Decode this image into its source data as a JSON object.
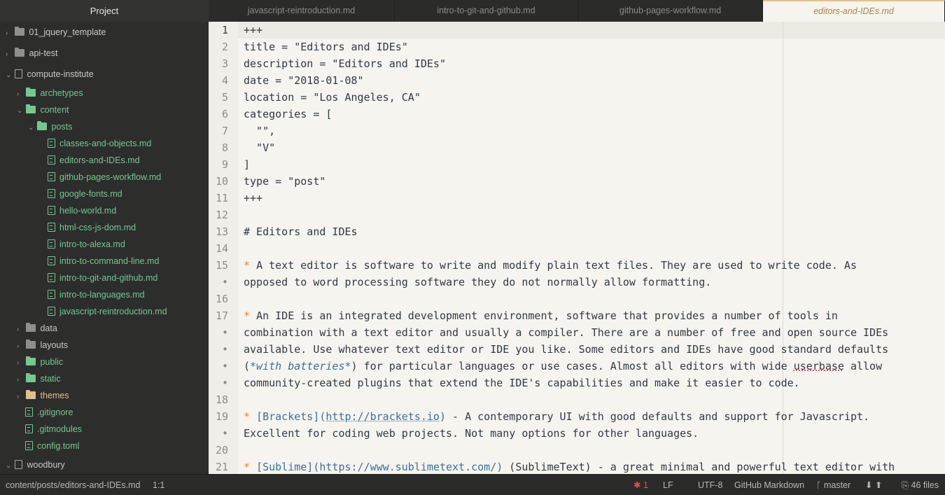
{
  "sidebar": {
    "title": "Project",
    "rows": [
      {
        "label": "01_jquery_template",
        "type": "folder",
        "open": false,
        "color": "gray"
      },
      {
        "label": "api-test",
        "type": "folder",
        "open": false,
        "color": "gray"
      },
      {
        "label": "compute-institute",
        "type": "repo",
        "open": true,
        "color": "gray"
      },
      {
        "label": "archetypes",
        "type": "folder",
        "open": false,
        "color": "green"
      },
      {
        "label": "content",
        "type": "folder",
        "open": true,
        "color": "green"
      },
      {
        "label": "posts",
        "type": "folder",
        "open": true,
        "color": "green"
      },
      {
        "label": "classes-and-objects.md",
        "type": "file",
        "color": "green"
      },
      {
        "label": "editors-and-IDEs.md",
        "type": "file",
        "color": "green"
      },
      {
        "label": "github-pages-workflow.md",
        "type": "file",
        "color": "green"
      },
      {
        "label": "google-fonts.md",
        "type": "file",
        "color": "green"
      },
      {
        "label": "hello-world.md",
        "type": "file",
        "color": "green"
      },
      {
        "label": "html-css-js-dom.md",
        "type": "file",
        "color": "green"
      },
      {
        "label": "intro-to-alexa.md",
        "type": "file",
        "color": "green"
      },
      {
        "label": "intro-to-command-line.md",
        "type": "file",
        "color": "green"
      },
      {
        "label": "intro-to-git-and-github.md",
        "type": "file",
        "color": "green"
      },
      {
        "label": "intro-to-languages.md",
        "type": "file",
        "color": "green"
      },
      {
        "label": "javascript-reintroduction.md",
        "type": "file",
        "color": "green"
      },
      {
        "label": "data",
        "type": "folder",
        "open": false,
        "color": "gray"
      },
      {
        "label": "layouts",
        "type": "folder",
        "open": false,
        "color": "gray"
      },
      {
        "label": "public",
        "type": "folder",
        "open": false,
        "color": "green"
      },
      {
        "label": "static",
        "type": "folder",
        "open": false,
        "color": "green"
      },
      {
        "label": "themes",
        "type": "folder",
        "open": false,
        "color": "gold"
      },
      {
        "label": ".gitignore",
        "type": "file",
        "color": "green"
      },
      {
        "label": ".gitmodules",
        "type": "file",
        "color": "green"
      },
      {
        "label": "config.toml",
        "type": "file",
        "color": "green"
      },
      {
        "label": "woodbury",
        "type": "repo",
        "open": true,
        "color": "gray"
      }
    ]
  },
  "tabs": [
    {
      "label": "javascript-reintroduction.md",
      "active": false
    },
    {
      "label": "intro-to-git-and-github.md",
      "active": false
    },
    {
      "label": "github-pages-workflow.md",
      "active": false
    },
    {
      "label": "editors-and-IDEs.md",
      "active": true
    }
  ],
  "editor": {
    "lines": [
      {
        "num": "1",
        "segs": [
          {
            "t": "+++"
          }
        ]
      },
      {
        "num": "2",
        "segs": [
          {
            "t": "title = \"Editors and IDEs\""
          }
        ]
      },
      {
        "num": "3",
        "segs": [
          {
            "t": "description = \"Editors and IDEs\""
          }
        ]
      },
      {
        "num": "4",
        "segs": [
          {
            "t": "date = \"2018-01-08\""
          }
        ]
      },
      {
        "num": "5",
        "segs": [
          {
            "t": "location = \"Los Angeles, CA\""
          }
        ]
      },
      {
        "num": "6",
        "segs": [
          {
            "t": "categories = ["
          }
        ]
      },
      {
        "num": "7",
        "segs": [
          {
            "t": "  \"\","
          }
        ]
      },
      {
        "num": "8",
        "segs": [
          {
            "t": "  \"V\""
          }
        ]
      },
      {
        "num": "9",
        "segs": [
          {
            "t": "]"
          }
        ]
      },
      {
        "num": "10",
        "segs": [
          {
            "t": "type = \"post\""
          }
        ]
      },
      {
        "num": "11",
        "segs": [
          {
            "t": "+++"
          }
        ]
      },
      {
        "num": "12",
        "segs": []
      },
      {
        "num": "13",
        "segs": [
          {
            "t": "# Editors and IDEs"
          }
        ]
      },
      {
        "num": "14",
        "segs": []
      },
      {
        "num": "15",
        "segs": [
          {
            "t": "* ",
            "c": "bullet"
          },
          {
            "t": "A text editor is software to write and modify plain text files. They are used to write code. As"
          }
        ]
      },
      {
        "num": "•",
        "segs": [
          {
            "t": "opposed to word processing software they do not normally allow formatting."
          }
        ]
      },
      {
        "num": "16",
        "segs": []
      },
      {
        "num": "17",
        "segs": [
          {
            "t": "* ",
            "c": "bullet"
          },
          {
            "t": "An IDE is an integrated development environment, software that provides a number of tools in"
          }
        ]
      },
      {
        "num": "•",
        "segs": [
          {
            "t": "combination with a text editor and usually a compiler. There are a number of free and open source IDEs"
          }
        ]
      },
      {
        "num": "•",
        "segs": [
          {
            "t": "available. Use whatever text editor or IDE you like. Some editors and IDEs have good standard defaults"
          }
        ]
      },
      {
        "num": "•",
        "segs": [
          {
            "t": "("
          },
          {
            "t": "*with batteries*",
            "c": "em"
          },
          {
            "t": ") for particular languages or use cases. Almost all editors with wide "
          },
          {
            "t": "userbase",
            "c": "misspell"
          },
          {
            "t": " allow"
          }
        ]
      },
      {
        "num": "•",
        "segs": [
          {
            "t": "community-created plugins that extend the IDE's capabilities and make it easier to code."
          }
        ]
      },
      {
        "num": "18",
        "segs": []
      },
      {
        "num": "19",
        "segs": [
          {
            "t": "* ",
            "c": "bullet"
          },
          {
            "t": "[Brackets](",
            "c": "link"
          },
          {
            "t": "http://brackets.io",
            "c": "url"
          },
          {
            "t": ")",
            "c": "link"
          },
          {
            "t": " - A contemporary UI with good defaults and support for Javascript."
          }
        ]
      },
      {
        "num": "•",
        "segs": [
          {
            "t": "Excellent for coding web projects. Not many options for other languages."
          }
        ]
      },
      {
        "num": "20",
        "segs": []
      },
      {
        "num": "21",
        "segs": [
          {
            "t": "* ",
            "c": "bullet"
          },
          {
            "t": "[Sublime](",
            "c": "link"
          },
          {
            "t": "https://www.sublimetext.com/",
            "c": "link"
          },
          {
            "t": ")",
            "c": "link"
          },
          {
            "t": " (SublimeText) - a great minimal and powerful text editor with"
          }
        ]
      }
    ]
  },
  "status": {
    "path": "content/posts/editors-and-IDEs.md",
    "cursor": "1:1",
    "issues": "1",
    "line_ending": "LF",
    "encoding": "UTF-8",
    "grammar": "GitHub Markdown",
    "branch": "master",
    "files": "46 files"
  }
}
